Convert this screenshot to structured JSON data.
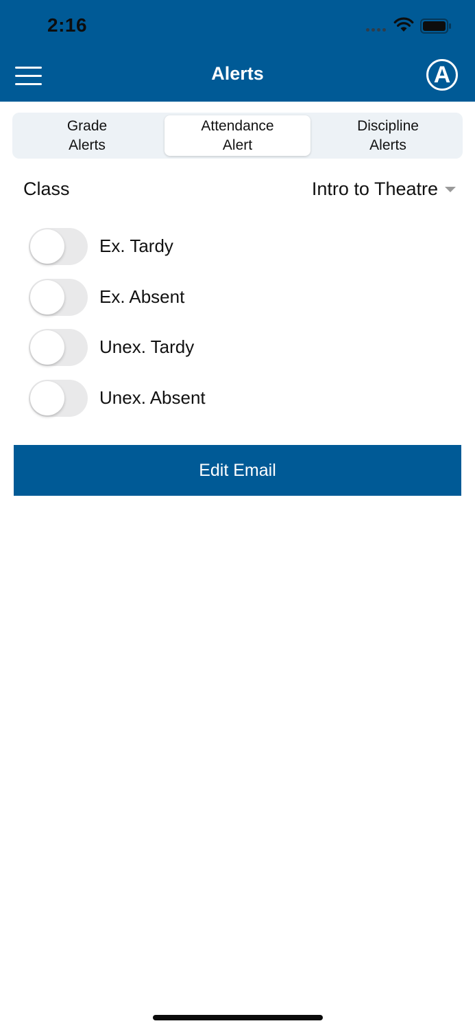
{
  "status_bar": {
    "time": "2:16"
  },
  "header": {
    "title": "Alerts",
    "avatar_letter": "A"
  },
  "tabs": [
    {
      "label": "Grade\nAlerts",
      "active": false
    },
    {
      "label": "Attendance\nAlert",
      "active": true
    },
    {
      "label": "Discipline\nAlerts",
      "active": false
    }
  ],
  "class_selector": {
    "label": "Class",
    "value": "Intro to Theatre"
  },
  "toggles": [
    {
      "label": "Ex. Tardy",
      "on": false
    },
    {
      "label": "Ex. Absent",
      "on": false
    },
    {
      "label": "Unex. Tardy",
      "on": false
    },
    {
      "label": "Unex. Absent",
      "on": false
    }
  ],
  "edit_email_button": {
    "label": "Edit Email"
  },
  "colors": {
    "primary": "#005a96",
    "segment_bg": "#edf2f6",
    "toggle_off": "#e9e9ea"
  },
  "icons": [
    "signal-icon",
    "wifi-icon",
    "battery-icon",
    "menu-icon",
    "avatar",
    "dropdown-icon"
  ]
}
